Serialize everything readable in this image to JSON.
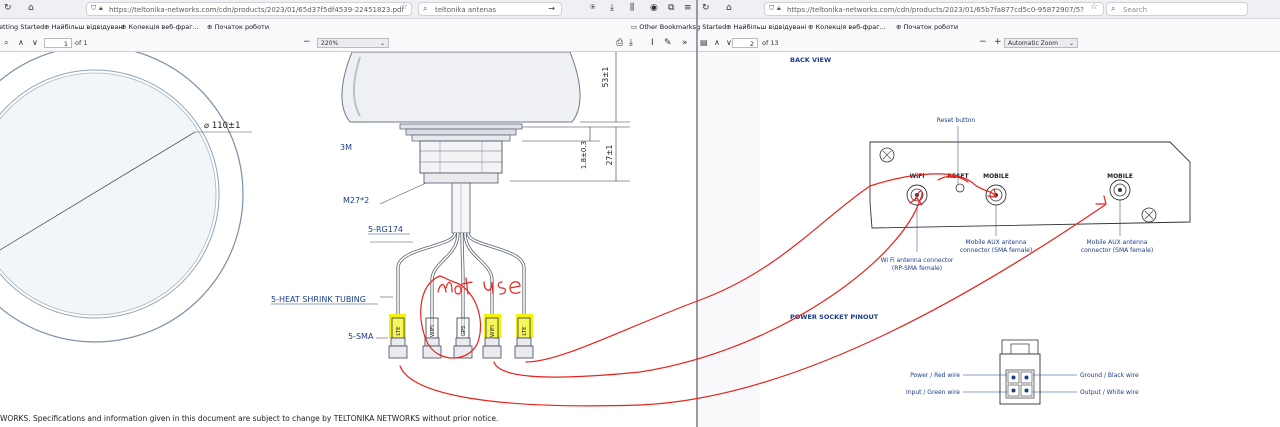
{
  "left_window": {
    "url": "https://teltonika-networks.com/cdn/products/2023/01/65d37f5df4539-22451823.pdf",
    "search_text": "teltonika  antenas",
    "bookmarks": [
      "Getting Started",
      "Найбільш відвідувані",
      "Колекція веб-фраг...",
      "Початок роботи",
      "Other Bookmarks"
    ],
    "page_number": "1",
    "page_count": "of 1",
    "zoom": "220%",
    "drawing": {
      "diameter_label": "⌀ 110±1",
      "adhesive_label": "3M",
      "thread_label": "M27*2",
      "cable_label": "5-RG174",
      "tubing_label": "5-HEAT SHRINK TUBING",
      "connector_label": "5-SMA",
      "dim_height": "53±1",
      "dim_thread": "27±1",
      "dim_base": "1.8±0.3",
      "tag_labels": [
        "LTE",
        "WIFI",
        "GPS",
        "WIFI",
        "LTE"
      ]
    },
    "handwritten_note": "not use",
    "footer_text": "WORKS. Specifications and information given in this document are subject to change by TELTONIKA NETWORKS without prior notice."
  },
  "right_window": {
    "url": "https://teltonika-networks.com/cdn/products/2023/01/65b7fa877cd5c0-95872907/5?",
    "search_placeholder": "Search",
    "bookmarks": [
      "Getting Started",
      "Найбільш відвідувані",
      "Колекція веб-фраг...",
      "Початок роботи"
    ],
    "page_number": "2",
    "page_count": "of 13",
    "zoom": "Automatic Zoom",
    "sections": {
      "back_view": "BACK VIEW",
      "power_pinout": "POWER SOCKET PINOUT"
    },
    "router": {
      "reset_button": "Reset button",
      "port_wifi": "WiFi",
      "port_reset": "RESET",
      "port_mobile_1": "MOBILE",
      "port_mobile_2": "MOBILE",
      "wifi_caption_1": "Wi Fi antenna connector",
      "wifi_caption_2": "(RP-SMA female)",
      "mobile_aux_1a": "Mobile AUX antenna",
      "mobile_aux_1b": "connector (SMA female)",
      "mobile_aux_2a": "Mobile AUX antenna",
      "mobile_aux_2b": "connector (SMA female)"
    },
    "pinout": {
      "power": "Power / Red wire",
      "input": "Input / Green wire",
      "ground": "Ground / Black wire",
      "output": "Output / White wire"
    }
  },
  "colors": {
    "annotation_red": "#e8231e",
    "highlight_yellow": "#f2f20a",
    "link_blue": "#1c3d8a",
    "pdf_bg": "#ffffff"
  }
}
